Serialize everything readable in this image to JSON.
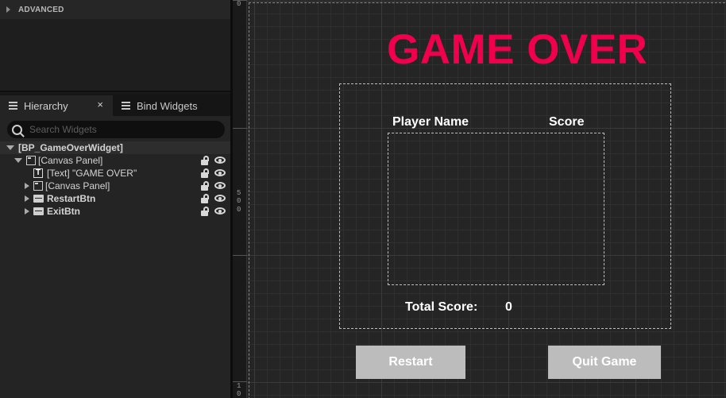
{
  "advanced": {
    "label": "ADVANCED"
  },
  "tabs": {
    "hierarchy": "Hierarchy",
    "bind_widgets": "Bind Widgets",
    "close": "×"
  },
  "search": {
    "placeholder": "Search Widgets"
  },
  "tree": [
    {
      "label": "[BP_GameOverWidget]",
      "bold": true
    },
    {
      "label": "[Canvas Panel]"
    },
    {
      "label": "[Text] \"GAME OVER\""
    },
    {
      "label": "[Canvas Panel]"
    },
    {
      "label": "RestartBtn",
      "bold": true
    },
    {
      "label": "ExitBtn",
      "bold": true
    }
  ],
  "ruler": {
    "marks": [
      "0",
      "5",
      "0",
      "0",
      "1",
      "0"
    ]
  },
  "canvas": {
    "title": "GAME OVER",
    "title_color": "#f0004c",
    "col_player": "Player Name",
    "col_score": "Score",
    "total_label": "Total Score:",
    "total_value": "0",
    "restart_label": "Restart",
    "quit_label": "Quit Game"
  },
  "icons": [
    "list-icon",
    "close-icon",
    "search-icon",
    "expand-arrow-icon",
    "collapse-arrow-icon",
    "canvas-panel-icon",
    "text-widget-icon",
    "button-widget-icon",
    "lock-icon",
    "eye-icon"
  ]
}
